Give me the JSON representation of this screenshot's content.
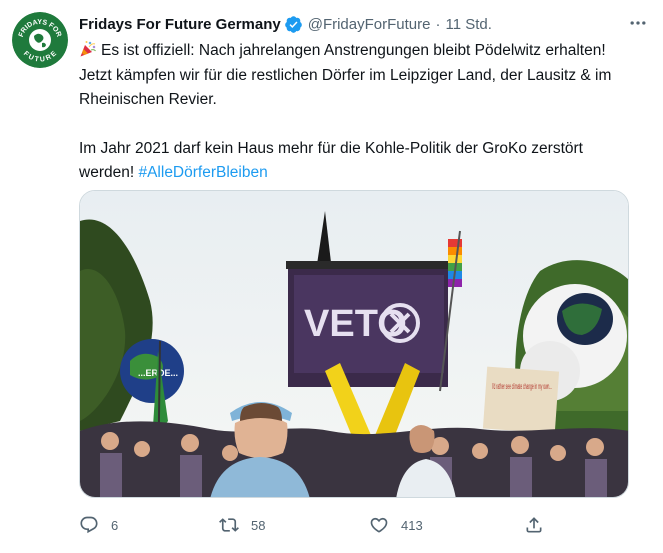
{
  "author": {
    "name": "Fridays For Future Germany",
    "handle": "@FridayForFuture",
    "separator": "·",
    "time": "11 Std.",
    "avatar_text_top": "FRIDAYS FOR",
    "avatar_text_bottom": "FUTURE"
  },
  "tweet": {
    "paragraph1": "Es ist offiziell: Nach jahrelangen Anstrengungen bleibt Pödelwitz erhalten! Jetzt kämpfen wir für die restlichen Dörfer im Leipziger Land, der Lausitz & im Rheinischen Revier.",
    "paragraph2_text": "Im Jahr 2021 darf kein Haus mehr für die Kohle-Politik der GroKo zerstört werden!",
    "hashtag": "#AlleDörferBleiben",
    "emoji": "party-popper-icon"
  },
  "media": {
    "banner_text": "VETO",
    "balloon_text": "...ERDE...",
    "sign_text": "I'd rather see climate change in my own..."
  },
  "actions": {
    "replies": "6",
    "retweets": "58",
    "likes": "413"
  },
  "colors": {
    "accent": "#1d9bf0",
    "muted": "#536471",
    "text": "#0f1419",
    "avatar_green": "#1f7a3c"
  }
}
